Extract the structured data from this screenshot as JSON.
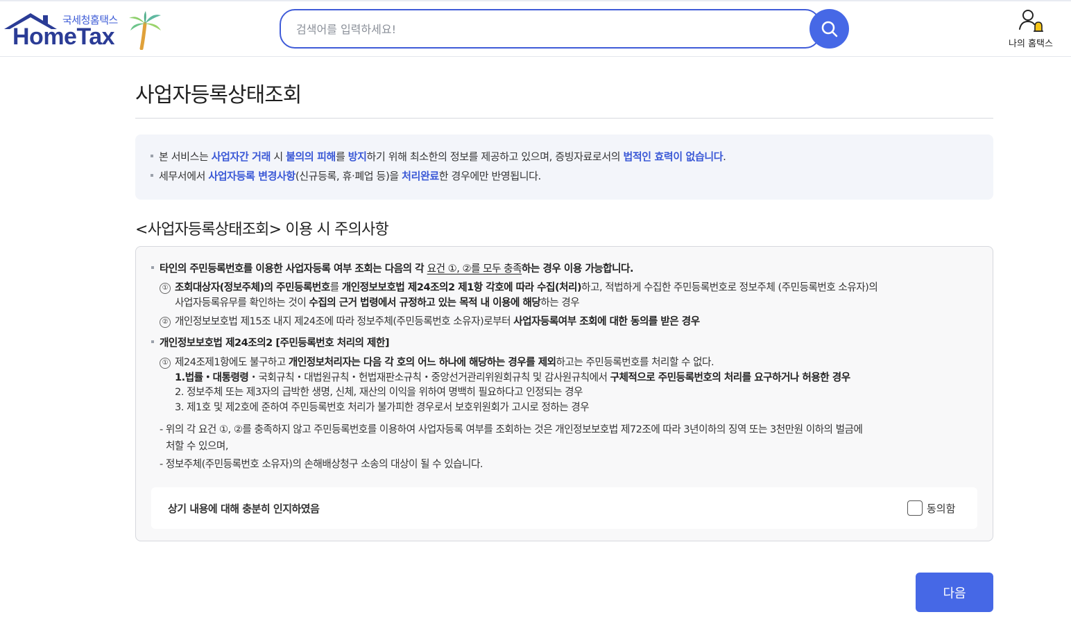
{
  "header": {
    "logo_sub": "국세청홈택스",
    "logo_main": "HomeTax",
    "search_placeholder": "검색어를 입력하세요!",
    "myhome_label": "나의 홈택스"
  },
  "page": {
    "title": "사업자등록상태조회"
  },
  "notice": {
    "line1": {
      "p1": "본 서비스는 ",
      "h1": "사업자간 거래",
      "p2": " 시 ",
      "h2": "불의의 피해",
      "p3": "를 ",
      "h3": "방지",
      "p4": "하기 위해 최소한의 정보를 제공하고 있으며, 증빙자료로서의 ",
      "h4": "법적인 효력이 없습니다",
      "p5": "."
    },
    "line2": {
      "p1": "세무서에서 ",
      "h1": "사업자등록 변경사항",
      "p2": "(신규등록, 휴·폐업 등)을 ",
      "h2": "처리완료",
      "p3": "한 경우에만 반영됩니다."
    }
  },
  "caution": {
    "title": "<사업자등록상태조회> 이용 시 주의사항",
    "b1": {
      "s1": "타인의 주민등록번호를 이용한 사업자등록 여부 조회는 다음의 각 ",
      "s2": "요건 ①, ②를 모두 충족",
      "s3": "하는 경우 이용 가능합니다."
    },
    "item1": {
      "num": "①",
      "b1": "조회대상자(정보주체)의 주민등록번호",
      "t1": "를 ",
      "b2": "개인정보보호법 제24조의2 제1항 각호에 따라 수집(처리)",
      "t2": "하고, 적법하게 수집한 주민등록번호로 정보주체 (주민등록번호 소유자)의",
      "l2a": "사업자등록유무를 확인하는 것이 ",
      "l2b": "수집의 근거 법령에서 규정하고 있는 목적 내 이용에 해당",
      "l2c": "하는 경우"
    },
    "item2": {
      "num": "②",
      "t1": "개인정보보호법 제15조 내지 제24조에 따라 정보주체(주민등록번호 소유자)로부터 ",
      "b1": "사업자등록여부 조회에 대한 동의를 받은 경우"
    },
    "b2": "개인정보보호법 제24조의2 [주민등록번호 처리의 제한]",
    "law1": {
      "num": "①",
      "t1": "제24조제1항에도 불구하고 ",
      "b1": "개인정보처리자는 다음 각 호의 어느 하나에 해당하는 경우를 제외",
      "t2": "하고는 주민등록번호를 처리할 수 없다."
    },
    "law_items": {
      "i1a": "1.법률・대통령령",
      "i1b": "・국회규칙・대법원규칙・헌법재판소규칙・중앙선거관리위원회규칙 및 감사원규칙에서 ",
      "i1c": "구체적으로 주민등록번호의 처리를 요구하거나 허용한 경우",
      "i2": "2. 정보주체 또는 제3자의 급박한 생명, 신체, 재산의 이익을 위하여 명백히 필요하다고 인정되는 경우",
      "i3": "3. 제1호 및 제2호에 준하여 주민등록번호 처리가 불가피한 경우로서 보호위원회가 고시로 정하는 경우"
    },
    "penalty1": "- 위의 각 요건 ①, ②를 충족하지 않고 주민등록번호를 이용하여 사업자등록 여부를 조회하는 것은 개인정보보호법 제72조에 따라 3년이하의 징역 또는 3천만원 이하의 벌금에",
    "penalty1b": "처할 수 있으며,",
    "penalty2": "- 정보주체(주민등록번호 소유자)의 손해배상청구 소송의 대상이 될 수 있습니다."
  },
  "agree": {
    "text": "상기 내용에 대해 충분히 인지하였음",
    "checkbox_label": "동의함",
    "checked": false
  },
  "actions": {
    "next_label": "다음"
  },
  "colors": {
    "accent": "#4668e6",
    "highlight_text": "#3a58d6",
    "logo": "#2b3c96"
  }
}
